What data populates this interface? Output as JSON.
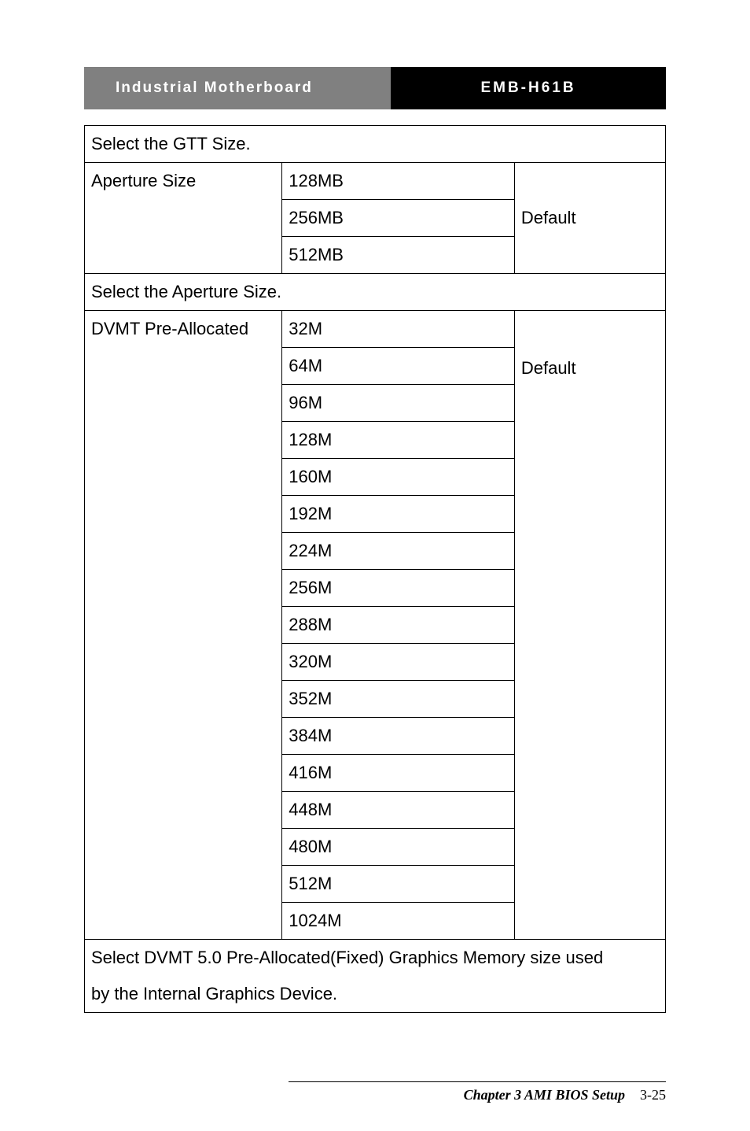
{
  "header": {
    "left": "Industrial Motherboard",
    "right": "EMB-H61B"
  },
  "rows": {
    "gtt_desc": "Select the GTT Size.",
    "aperture_label": "Aperture Size",
    "aperture_opts": [
      "128MB",
      "256MB",
      "512MB"
    ],
    "aperture_default": "Default",
    "aperture_desc": "Select the Aperture Size.",
    "dvmt_label": "DVMT Pre-Allocated",
    "dvmt_opts": [
      "32M",
      "64M",
      "96M",
      "128M",
      "160M",
      "192M",
      "224M",
      "256M",
      "288M",
      "320M",
      "352M",
      "384M",
      "416M",
      "448M",
      "480M",
      "512M",
      "1024M"
    ],
    "dvmt_default": "Default",
    "dvmt_desc_line1": "Select DVMT 5.0 Pre-Allocated(Fixed) Graphics Memory size used",
    "dvmt_desc_line2": "by the Internal Graphics Device."
  },
  "footer": {
    "chapter": "Chapter 3 AMI BIOS Setup",
    "page": "3-25"
  }
}
